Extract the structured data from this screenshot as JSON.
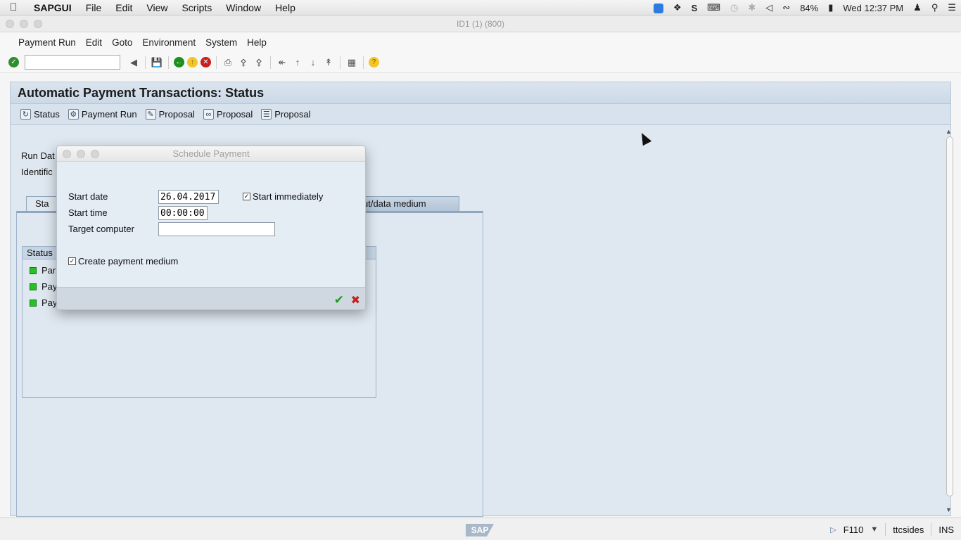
{
  "menubar": {
    "app": "SAPGUI",
    "items": [
      "File",
      "Edit",
      "View",
      "Scripts",
      "Window",
      "Help"
    ],
    "battery": "84%",
    "clock": "Wed 12:37 PM"
  },
  "window": {
    "title": "ID1 (1) (800)"
  },
  "sap_menu": {
    "items": [
      "Payment Run",
      "Edit",
      "Goto",
      "Environment",
      "System",
      "Help"
    ]
  },
  "command_field": {
    "value": ""
  },
  "screen": {
    "title": "Automatic Payment Transactions: Status",
    "app_toolbar": [
      "Status",
      "Payment Run",
      "Proposal",
      "Proposal",
      "Proposal"
    ],
    "run_date_label": "Run Dat",
    "identification_label": "Identific",
    "tabs": [
      "Sta",
      "ut/data medium"
    ],
    "status_group": {
      "title": "Status",
      "items": [
        "Para",
        "Pay",
        "Pay"
      ]
    }
  },
  "dialog": {
    "title": "Schedule Payment",
    "start_date_label": "Start date",
    "start_date_value": "26.04.2017",
    "start_time_label": "Start time",
    "start_time_value": "00:00:00",
    "target_computer_label": "Target computer",
    "target_computer_value": "",
    "start_immediately_label": "Start immediately",
    "start_immediately_checked": true,
    "create_payment_medium_label": "Create payment medium",
    "create_payment_medium_checked": true
  },
  "statusbar": {
    "logo": "SAP",
    "transaction": "F110",
    "user": "ttcsides",
    "mode": "INS"
  }
}
